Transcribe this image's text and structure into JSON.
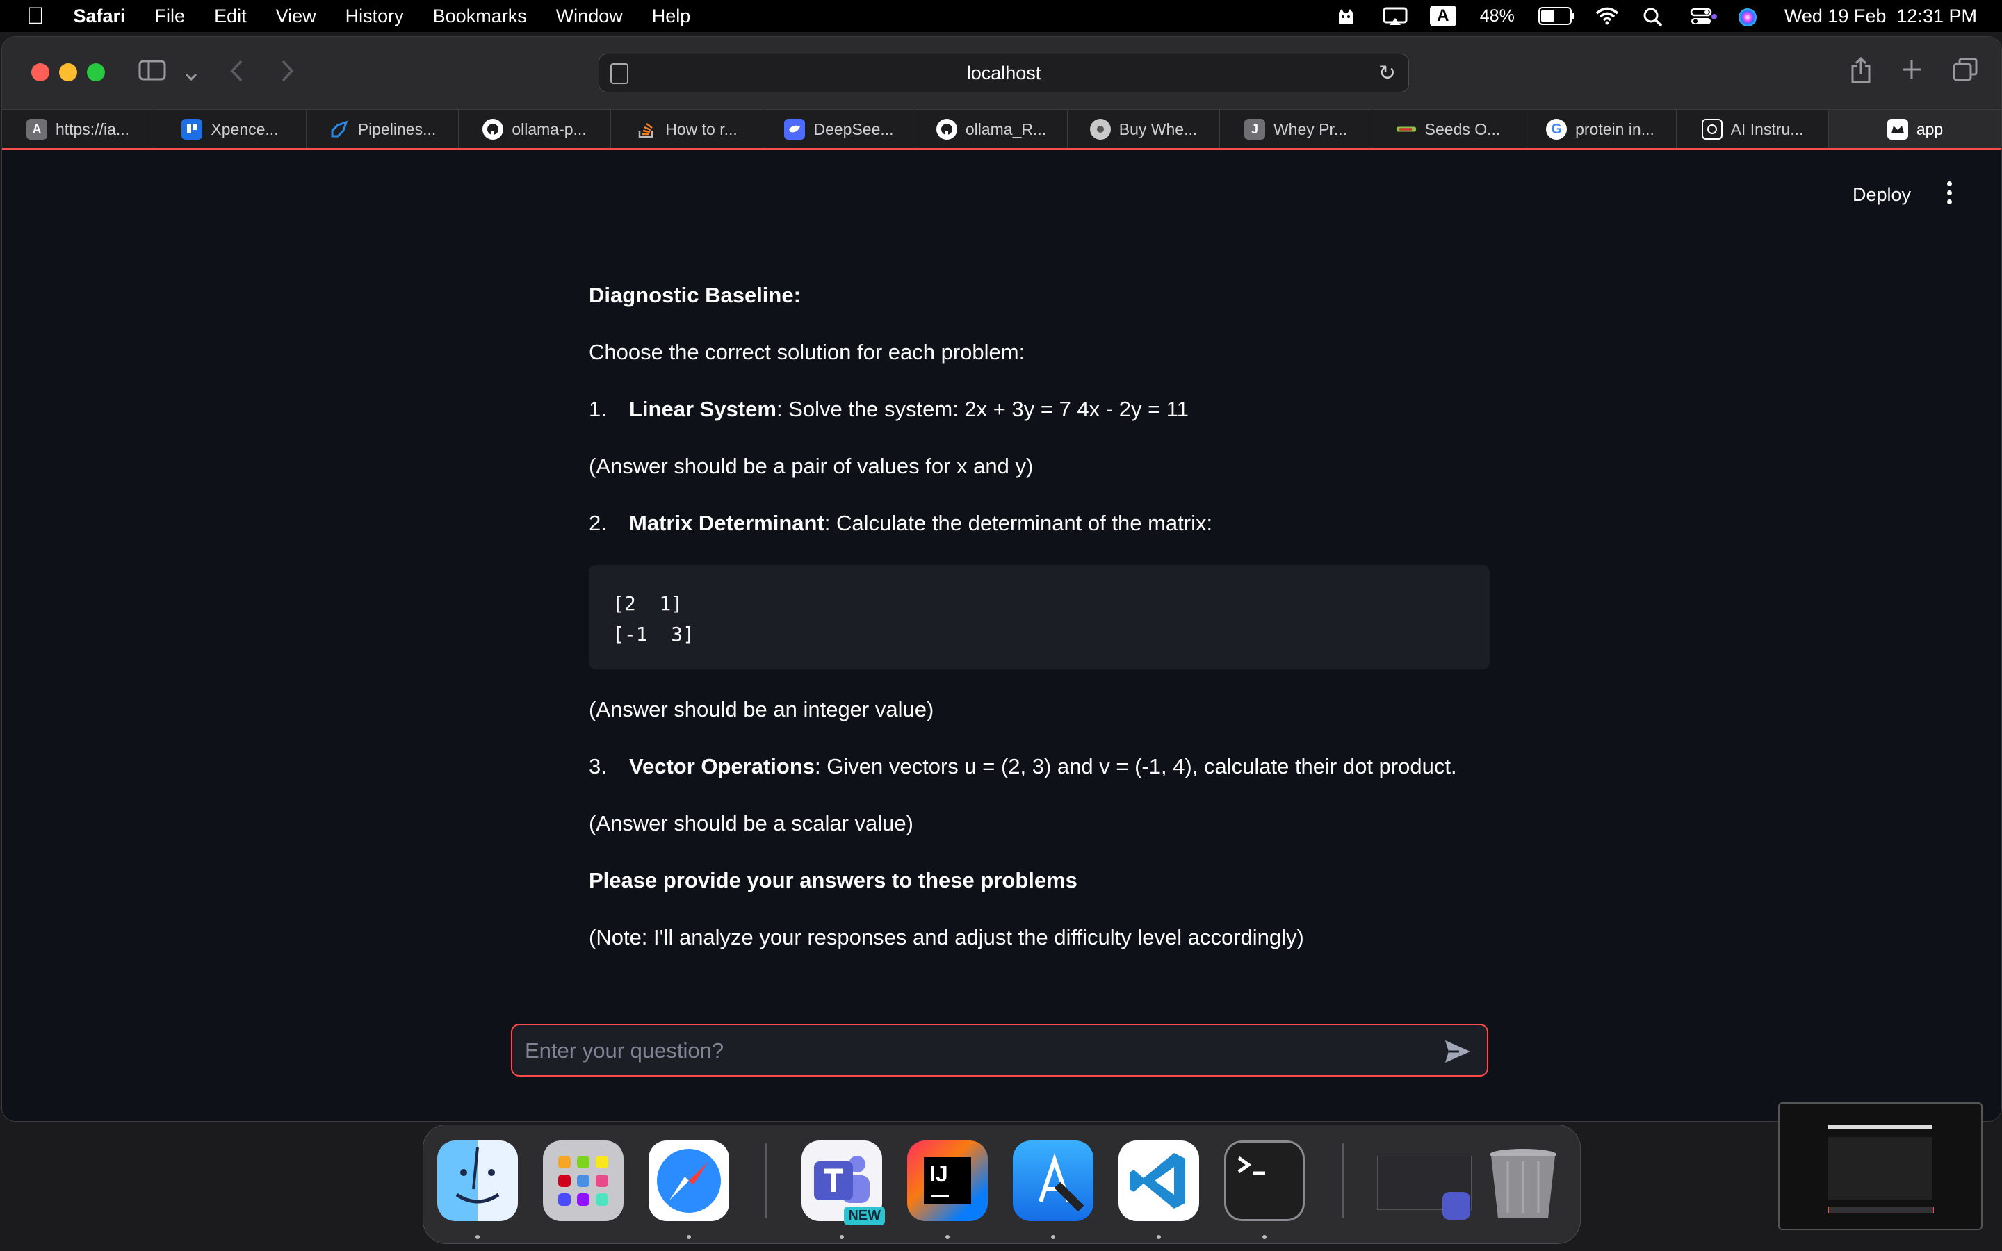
{
  "menubar": {
    "app": "Safari",
    "items": [
      "File",
      "Edit",
      "View",
      "History",
      "Bookmarks",
      "Window",
      "Help"
    ],
    "battery": "48%",
    "battery_level": 0.48,
    "input_source": "A",
    "clock": "Wed 19 Feb  12:31 PM"
  },
  "browser": {
    "address": "localhost",
    "tabs": [
      {
        "label": "https://ia...",
        "icon": "a-letter-icon",
        "color": "#6e6e73"
      },
      {
        "label": "Xpence...",
        "icon": "trello-icon",
        "color": "#1d6fe6"
      },
      {
        "label": "Pipelines...",
        "icon": "azure-pipelines-icon",
        "color": "#2a8ae6"
      },
      {
        "label": "ollama-p...",
        "icon": "github-icon",
        "color": "#ffffff"
      },
      {
        "label": "How to r...",
        "icon": "stack-overflow-icon",
        "color": "#f48024"
      },
      {
        "label": "DeepSee...",
        "icon": "deepseek-icon",
        "color": "#4d6bfe"
      },
      {
        "label": "ollama_R...",
        "icon": "github-icon",
        "color": "#ffffff"
      },
      {
        "label": "Buy Whe...",
        "icon": "site-icon",
        "color": "#c9c9c9"
      },
      {
        "label": "Whey Pr...",
        "icon": "j-letter-icon",
        "color": "#6e6e73"
      },
      {
        "label": "Seeds O...",
        "icon": "seeds-icon",
        "color": "#8bc34a"
      },
      {
        "label": "protein in...",
        "icon": "google-icon",
        "color": "#4285f4"
      },
      {
        "label": "AI Instru...",
        "icon": "openai-icon",
        "color": "#ffffff"
      },
      {
        "label": "app",
        "icon": "streamlit-icon",
        "color": "#ffffff",
        "active": true
      }
    ]
  },
  "header": {
    "deploy": "Deploy"
  },
  "message": {
    "heading": "Diagnostic Baseline:",
    "intro": "Choose the correct solution for each problem:",
    "problems": [
      {
        "num": "1.",
        "title": "Linear System",
        "text": ": Solve the system: 2x + 3y = 7 4x - 2y = 11",
        "hint": "(Answer should be a pair of values for x and y)"
      },
      {
        "num": "2.",
        "title": "Matrix Determinant",
        "text": ": Calculate the determinant of the matrix:",
        "hint": "(Answer should be an integer value)"
      },
      {
        "num": "3.",
        "title": "Vector Operations",
        "text": ": Given vectors u = (2, 3) and v = (-1, 4), calculate their dot product.",
        "hint": "(Answer should be a scalar value)"
      }
    ],
    "matrix": "[2  1]\n[-1  3]",
    "request": "Please provide your answers to these problems",
    "note": "(Note: I'll analyze your responses and adjust the difficulty level accordingly)"
  },
  "chat": {
    "placeholder": "Enter your question?"
  },
  "dock": {
    "apps": [
      "finder-icon",
      "launchpad-icon",
      "safari-icon",
      "teams-icon",
      "intellij-icon",
      "xcode-icon",
      "vscode-icon",
      "terminal-icon",
      "teams-window-icon",
      "trash-icon"
    ],
    "teams_badge": "NEW",
    "intellij_label": "IJ"
  },
  "colors": {
    "accent": "#ff4b4b",
    "background": "#0e1117",
    "code_background": "#1c1e25"
  }
}
